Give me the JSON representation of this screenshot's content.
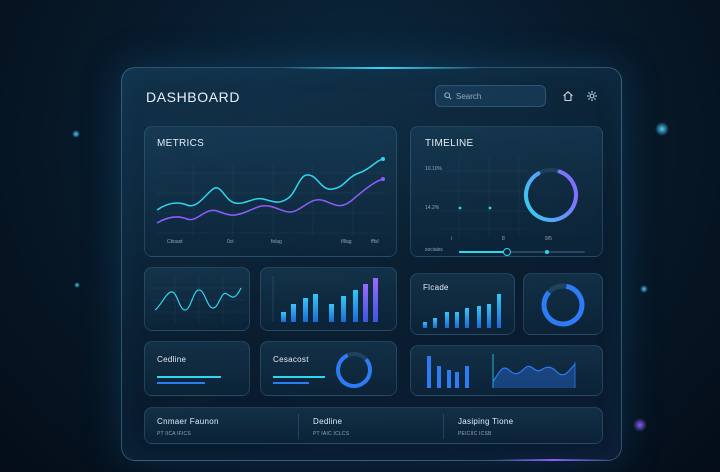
{
  "header": {
    "title": "DASHBOARD",
    "search_placeholder": "Search",
    "home_icon": "home-icon",
    "settings_icon": "gear-icon"
  },
  "metrics": {
    "label": "METRICS",
    "axis_labels": [
      "Ctioast",
      "0ct",
      "felag",
      "Ifllag",
      "fffsl"
    ]
  },
  "timeline": {
    "label": "TIMELINE",
    "rows": [
      "10.10%",
      "14.2%"
    ],
    "ticks": [
      "i",
      "8",
      "9/5"
    ],
    "slider_label": "sociaiss",
    "slider_value": 0.38
  },
  "flowcard": {
    "label": "Flcade"
  },
  "deadline_card": {
    "label": "Cedline",
    "bar1": 0.75,
    "bar2": 0.55
  },
  "cesacast_card": {
    "label": "Cesacost",
    "bar1": 0.7,
    "bar2": 0.5
  },
  "footer": {
    "items": [
      {
        "title": "Cnmaer Faunon",
        "sub": "PT IICA IFICS"
      },
      {
        "title": "Dedline",
        "sub": "PT IAIC ICLCS"
      },
      {
        "title": "Jasiping Tione",
        "sub": "PEICIIC ICSB"
      }
    ]
  },
  "colors": {
    "cyan": "#2fd6f0",
    "purple": "#8f5cff",
    "blue": "#2d7cf6",
    "background": "#081b2c"
  }
}
